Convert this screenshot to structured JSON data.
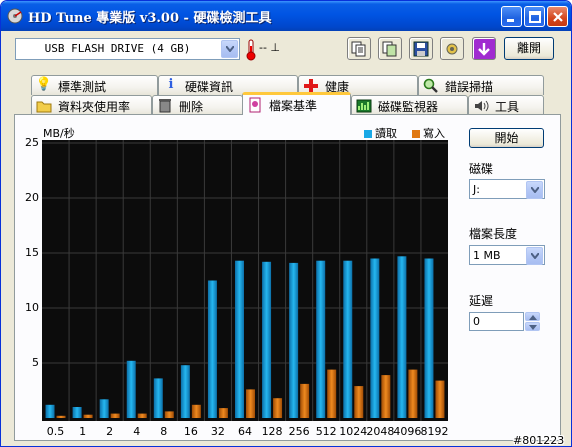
{
  "window": {
    "title": "HD Tune 專業版 v3.00 - 硬碟檢測工具"
  },
  "toolbar": {
    "drive": "USB FLASH DRIVE (4 GB)",
    "temperature": "-- ⊥",
    "exit_label": "離開",
    "icons": [
      "copy-text-icon",
      "copy-screenshot-icon",
      "save-icon",
      "options-icon",
      "download-icon"
    ]
  },
  "tabs": {
    "row_top": [
      {
        "label": "標準測試",
        "icon": "lightbulb-icon"
      },
      {
        "label": "硬碟資訊",
        "icon": "info-icon"
      },
      {
        "label": "健康",
        "icon": "health-cross-icon"
      },
      {
        "label": "錯誤掃描",
        "icon": "magnifier-icon"
      }
    ],
    "row_bottom": [
      {
        "label": "資料夾使用率",
        "icon": "folder-icon"
      },
      {
        "label": "刪除",
        "icon": "trash-icon"
      },
      {
        "label": "檔案基準",
        "icon": "file-benchmark-icon"
      },
      {
        "label": "磁碟監視器",
        "icon": "monitor-chart-icon"
      },
      {
        "label": "工具",
        "icon": "speaker-icon"
      }
    ],
    "active": "檔案基準"
  },
  "side": {
    "start_label": "開始",
    "disk_label": "磁碟",
    "disk_value": "J:",
    "file_length_label": "檔案長度",
    "file_length_value": "1 MB",
    "delay_label": "延遲",
    "delay_value": "0"
  },
  "watermark": "#801223",
  "chart_data": {
    "type": "bar",
    "ylabel": "MB/秒",
    "ylim": [
      0,
      25
    ],
    "y_ticks": [
      "25",
      "20",
      "15",
      "10",
      "5"
    ],
    "categories": [
      "0.5",
      "1",
      "2",
      "4",
      "8",
      "16",
      "32",
      "64",
      "128",
      "256",
      "512",
      "1024",
      "2048",
      "4096",
      "8192"
    ],
    "series": [
      {
        "name": "讀取",
        "color": "#19a8e6",
        "values": [
          1.2,
          1.0,
          1.7,
          5.2,
          3.6,
          4.8,
          12.5,
          14.3,
          14.2,
          14.1,
          14.3,
          14.3,
          14.5,
          14.7,
          14.5
        ]
      },
      {
        "name": "寫入",
        "color": "#e07812",
        "values": [
          0.2,
          0.3,
          0.4,
          0.4,
          0.6,
          1.2,
          0.9,
          2.6,
          1.8,
          3.1,
          4.4,
          2.9,
          3.9,
          4.4,
          3.4
        ]
      }
    ],
    "grid": true,
    "legend": "top-right"
  }
}
